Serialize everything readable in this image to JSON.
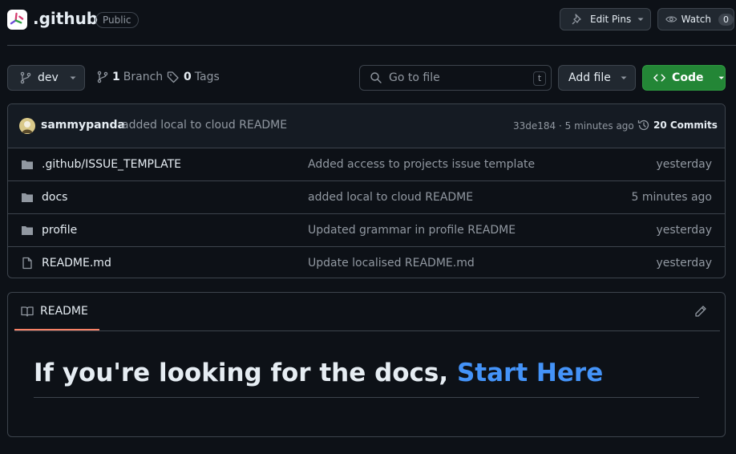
{
  "repo": {
    "name": ".github",
    "visibility": "Public"
  },
  "header": {
    "edit_pins_label": "Edit Pins",
    "watch_label": "Watch",
    "watch_count": "0"
  },
  "toolbar": {
    "branch": "dev",
    "branch_count": "1",
    "branch_label": "Branch",
    "tag_count": "0",
    "tag_label": "Tags",
    "search_placeholder": "Go to file",
    "search_shortcut": "t",
    "add_file_label": "Add file",
    "code_label": "Code"
  },
  "latest_commit": {
    "author": "sammypanda",
    "message": "added local to cloud README",
    "hash_time": "33de184 · 5 minutes ago",
    "commits_label": "20 Commits"
  },
  "files": [
    {
      "name": ".github/ISSUE_TEMPLATE",
      "type": "folder",
      "message": "Added access to projects issue template",
      "time": "yesterday"
    },
    {
      "name": "docs",
      "type": "folder",
      "message": "added local to cloud README",
      "time": "5 minutes ago"
    },
    {
      "name": "profile",
      "type": "folder",
      "message": "Updated grammar in profile README",
      "time": "yesterday"
    },
    {
      "name": "README.md",
      "type": "file",
      "message": "Update localised README.md",
      "time": "yesterday"
    }
  ],
  "readme": {
    "tab_label": "README",
    "heading_text": "If you're looking for the docs, ",
    "heading_link": "Start Here"
  },
  "colors": {
    "background": "#0d1117",
    "accent_link": "#4493f8",
    "code_button": "#238636",
    "tab_underline": "#f78166"
  }
}
